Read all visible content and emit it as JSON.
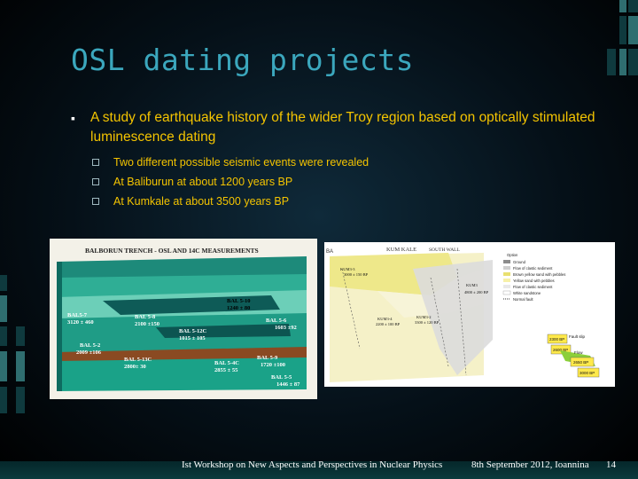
{
  "slide": {
    "title": "OSL dating projects",
    "bullet_main": "A study of earthquake history of the wider Troy region based on optically stimulated luminescence dating",
    "sub_bullets": [
      "Two different possible seismic events were revealed",
      "At Baliburun at about 1200 years BP",
      "At Kumkale at about 3500 years BP"
    ]
  },
  "figure_left": {
    "title": "BALBORUN TRENCH - OSL AND 14C MEASUREMENTS",
    "labels": [
      {
        "name": "BAL 5-10",
        "value": "1240 ± 80"
      },
      {
        "name": "BAL5-7",
        "value": "3120 ± 460"
      },
      {
        "name": "BAL 5-8",
        "value": "2100 ±150"
      },
      {
        "name": "BAL 5-12C",
        "value": "1015 ± 105"
      },
      {
        "name": "BAL 5-6",
        "value": "1603 ±92"
      },
      {
        "name": "BAL 5-2",
        "value": "2009 ±106"
      },
      {
        "name": "BAL 5-13C",
        "value": "2800± 30"
      },
      {
        "name": "BAL 5-4C",
        "value": "2855 ± 55"
      },
      {
        "name": "BAL 5-9",
        "value": "1720 ±100"
      },
      {
        "name": "BAL 5-5",
        "value": "1446 ± 87"
      }
    ]
  },
  "figure_right": {
    "corner_label": "BA",
    "title": "KUM KALE",
    "subtitle": "SOUTH WALL",
    "legend_title": "Option",
    "legend": [
      "Ground",
      "Flow of clastic sediment",
      "Brown yellow sand with pebbles",
      "Yellow sand with pebbles",
      "Flow of clastic sediment",
      "White sandstone",
      "Normal fault"
    ],
    "samples": [
      {
        "name": "KUM3-3",
        "value": "3000 ± 150 BP"
      },
      {
        "name": "KUM3-4",
        "value": "2200 ± 100 BP"
      },
      {
        "name": "KUM3-2",
        "value": "3300 ± 120 BP"
      },
      {
        "name": "KUM3",
        "value": "4800 ± 200 BP"
      }
    ],
    "side_labels": [
      "Fault slip",
      "Flow"
    ],
    "boxes": [
      "2300 BP",
      "2600 BP",
      "2650 BP",
      "3000 BP"
    ]
  },
  "footer": {
    "event": "Ist Workshop on New Aspects and Perspectives in Nuclear Physics",
    "date": "8th September 2012, Ioannina",
    "page": "14"
  }
}
